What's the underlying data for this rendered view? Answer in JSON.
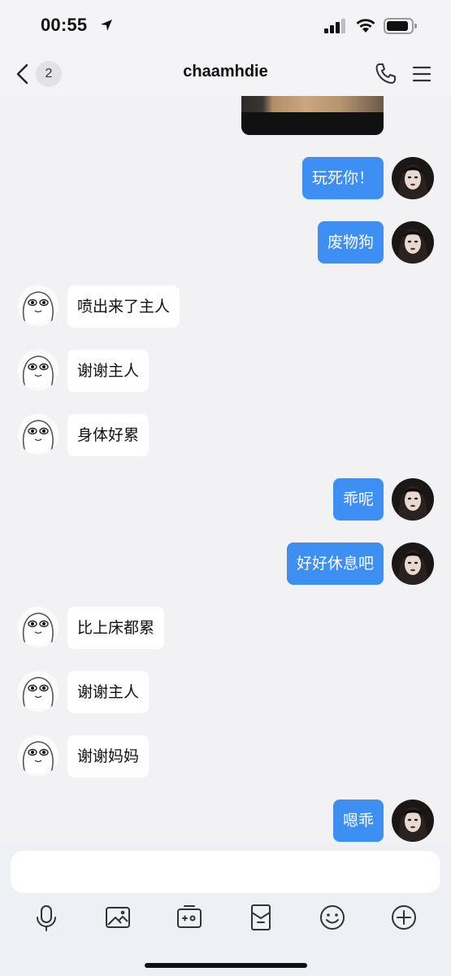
{
  "status_bar": {
    "time": "00:55",
    "icons": [
      "location-arrow-icon",
      "signal-icon",
      "wifi-icon",
      "battery-icon"
    ]
  },
  "header": {
    "unread_count": "2",
    "title": "chaamhdie",
    "icons": [
      "back-chevron-icon",
      "phone-icon",
      "menu-icon"
    ]
  },
  "messages": [
    {
      "from": "me",
      "text": "玩死你！"
    },
    {
      "from": "me",
      "text": "废物狗"
    },
    {
      "from": "friend",
      "text": "喷出来了主人"
    },
    {
      "from": "friend",
      "text": "谢谢主人"
    },
    {
      "from": "friend",
      "text": "身体好累"
    },
    {
      "from": "me",
      "text": "乖呢"
    },
    {
      "from": "me",
      "text": "好好休息吧"
    },
    {
      "from": "friend",
      "text": "比上床都累"
    },
    {
      "from": "friend",
      "text": "谢谢主人"
    },
    {
      "from": "friend",
      "text": "谢谢妈妈"
    },
    {
      "from": "me",
      "text": "嗯乖"
    }
  ],
  "composer": {
    "placeholder": "",
    "tools": [
      "microphone-icon",
      "image-icon",
      "camera-icon",
      "red-packet-icon",
      "emoji-icon",
      "plus-icon"
    ]
  },
  "colors": {
    "outgoing_bubble": "#3e8ff4",
    "incoming_bubble": "#ffffff",
    "background": "#f2f2f4"
  }
}
